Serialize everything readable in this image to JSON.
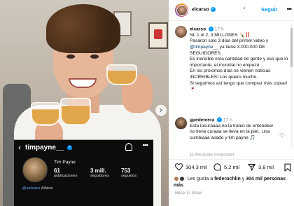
{
  "post": {
    "card": {
      "username": "timpayne__",
      "name": "Tim Payne",
      "stats": [
        {
          "value": "61",
          "label": "publicaciones"
        },
        {
          "value": "3 mill.",
          "label": "seguidores"
        },
        {
          "value": "753",
          "label": "seguidos"
        }
      ],
      "bio_handle": "@asiicanz",
      "bio_text": "Athlete"
    }
  },
  "header": {
    "username": "elcarso",
    "dot": "•",
    "follow_label": "Seguir",
    "more": "•••"
  },
  "caption": {
    "username": "elcarso",
    "time": "17 h",
    "line1": "NL 1 ni 2, 3 MILLONES 🍾‼️",
    "line2": "Pasaron solo 3 días del primer video y",
    "mention": "@timpayne__",
    "line3": "ya tiene 3.000.000 DE SEGUIDORES.",
    "line4": "Es increíble esta cantidad de gente y eso que lo importante, el mundial no empezó.",
    "line5": "En los próximos días se vienen noticias INCREIBLES! Los quiero mucho.",
    "line6": "Si seguimos así tengo que comprar más copas! 🍷"
  },
  "comment": {
    "username": "gpedemera",
    "time": "17 h",
    "text": "Esta locuraaaa no la traten de entendeer no tiene curaaa se lleva en la piel.. una cumbiaaa asado y tim payne 🎵",
    "partial": "11 Me gusta   Responder"
  },
  "actions": {
    "likes": "304,3 mil",
    "comments": "5,2 mil",
    "shares": "3,8 mil"
  },
  "likes_line": {
    "prefix": "Les gusta a",
    "user": "federochlin",
    "middle": "y",
    "count": "304 mil",
    "suffix": "personas más"
  },
  "ago": "Hace 17 horas",
  "colors": {
    "accent": "#0095f6",
    "verified": "#0095f6"
  }
}
